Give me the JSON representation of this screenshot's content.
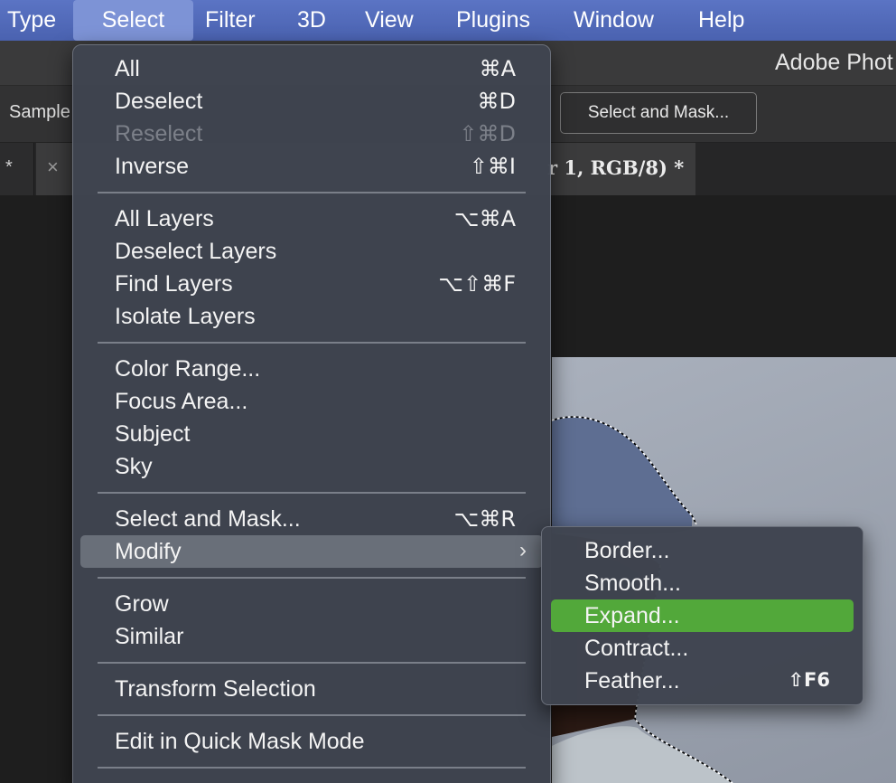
{
  "menubar": {
    "items": [
      "Type",
      "Select",
      "Filter",
      "3D",
      "View",
      "Plugins",
      "Window",
      "Help"
    ],
    "active": "Select"
  },
  "app": {
    "title": "Adobe Phot",
    "options_label": "Sample",
    "select_and_mask_button": "Select and Mask...",
    "tab_left_marker": "*",
    "tab_close": "×",
    "tab_title": "r 1, RGB/8) *"
  },
  "menu": {
    "items": [
      {
        "label": "All",
        "shortcut": "⌘A"
      },
      {
        "label": "Deselect",
        "shortcut": "⌘D"
      },
      {
        "label": "Reselect",
        "shortcut": "⇧⌘D",
        "disabled": true
      },
      {
        "label": "Inverse",
        "shortcut": "⇧⌘I"
      },
      {
        "label": "All Layers",
        "shortcut": "⌥⌘A"
      },
      {
        "label": "Deselect Layers",
        "shortcut": ""
      },
      {
        "label": "Find Layers",
        "shortcut": "⌥⇧⌘F"
      },
      {
        "label": "Isolate Layers",
        "shortcut": ""
      },
      {
        "label": "Color Range...",
        "shortcut": ""
      },
      {
        "label": "Focus Area...",
        "shortcut": ""
      },
      {
        "label": "Subject",
        "shortcut": ""
      },
      {
        "label": "Sky",
        "shortcut": ""
      },
      {
        "label": "Select and Mask...",
        "shortcut": "⌥⌘R"
      },
      {
        "label": "Modify",
        "shortcut": "",
        "submenu": true,
        "highlighted": true
      },
      {
        "label": "Grow",
        "shortcut": ""
      },
      {
        "label": "Similar",
        "shortcut": ""
      },
      {
        "label": "Transform Selection",
        "shortcut": ""
      },
      {
        "label": "Edit in Quick Mask Mode",
        "shortcut": ""
      }
    ],
    "submenu_chevron": "›"
  },
  "submenu": {
    "items": [
      {
        "label": "Border...",
        "shortcut": ""
      },
      {
        "label": "Smooth...",
        "shortcut": ""
      },
      {
        "label": "Expand...",
        "shortcut": "",
        "selected": true
      },
      {
        "label": "Contract...",
        "shortcut": ""
      },
      {
        "label": "Feather...",
        "shortcut": "⇧F6"
      }
    ]
  },
  "colors": {
    "menubar": "#4a62b0",
    "menu_bg": "#3f4450",
    "submenu_selection": "#52a83a"
  }
}
